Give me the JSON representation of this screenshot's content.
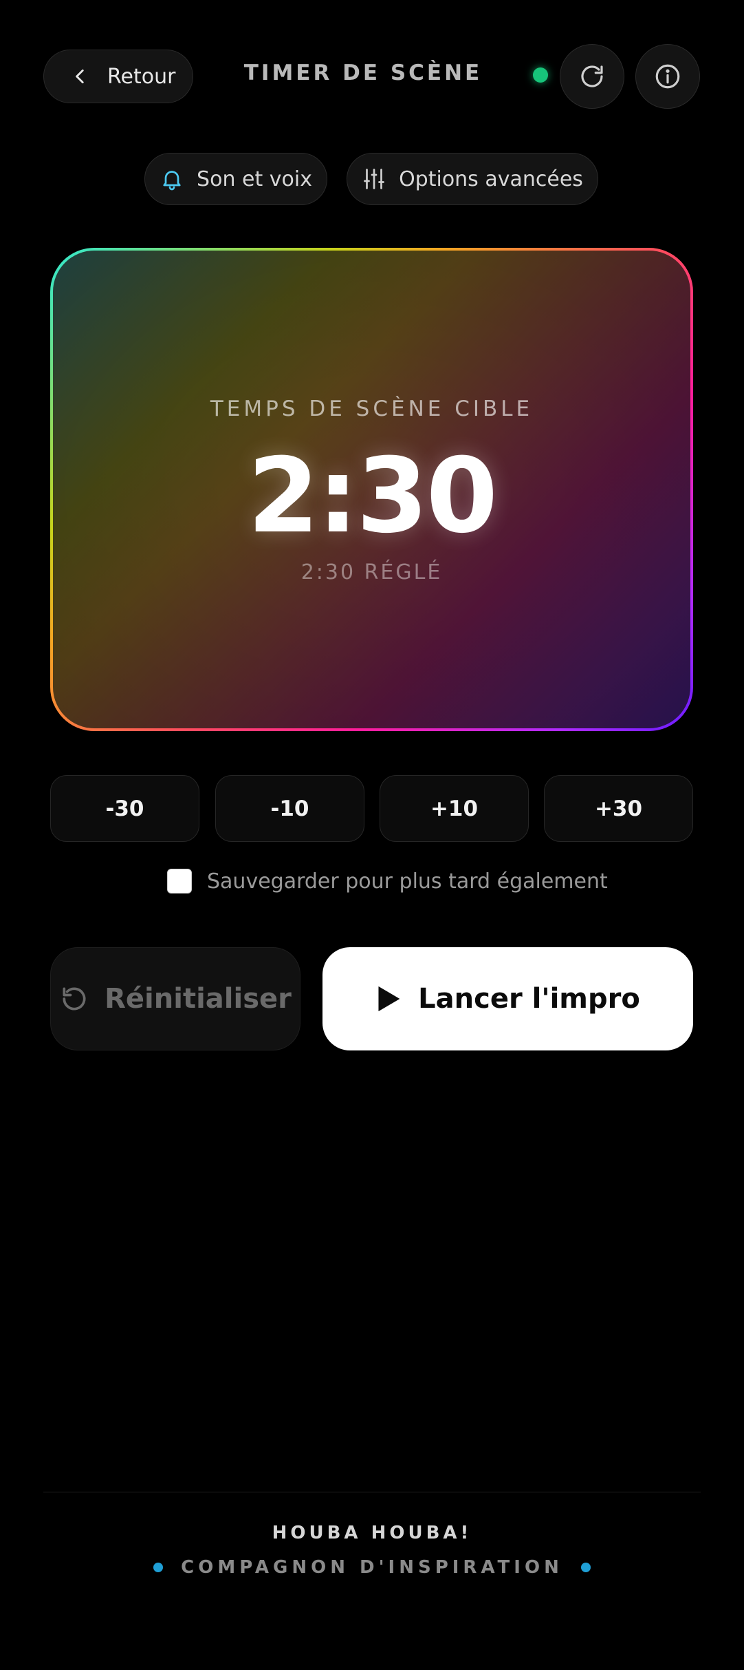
{
  "header": {
    "back_label": "Retour",
    "title": "TIMER DE SCÈNE",
    "status_color": "#17c47a"
  },
  "toolbar": {
    "sound_label": "Son et voix",
    "advanced_label": "Options avancées"
  },
  "timer": {
    "label": "TEMPS DE SCÈNE CIBLE",
    "time": "2:30",
    "subtext": "2:30 RÉGLÉ"
  },
  "adjust_buttons": [
    "-30",
    "-10",
    "+10",
    "+30"
  ],
  "save_option": {
    "label": "Sauvegarder pour plus tard également",
    "checked": false
  },
  "actions": {
    "reset_label": "Réinitialiser",
    "launch_label": "Lancer l'impro"
  },
  "footer": {
    "brand": "HOUBA HOUBA!",
    "tagline": "COMPAGNON D'INSPIRATION",
    "accent_color": "#1f9fd6"
  }
}
